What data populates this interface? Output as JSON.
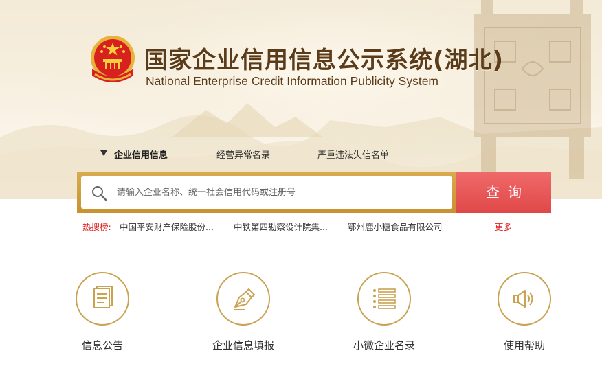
{
  "header": {
    "title_cn": "国家企业信用信息公示系统(湖北)",
    "title_en": "National Enterprise Credit Information Publicity System",
    "emblem": "national-emblem-icon"
  },
  "tabs": [
    {
      "label": "企业信用信息",
      "active": true
    },
    {
      "label": "经营异常名录",
      "active": false
    },
    {
      "label": "严重违法失信名单",
      "active": false
    }
  ],
  "search": {
    "placeholder": "请输入企业名称、统一社会信用代码或注册号",
    "value": "",
    "button_label": "查询"
  },
  "hot_search": {
    "label": "热搜榜:",
    "items": [
      "中国平安财产保险股份...",
      "中铁第四勘察设计院集...",
      "鄂州鹿小糖食品有限公司"
    ],
    "more": "更多"
  },
  "features": [
    {
      "label": "信息公告",
      "icon": "document-icon"
    },
    {
      "label": "企业信息填报",
      "icon": "pen-nib-icon"
    },
    {
      "label": "小微企业名录",
      "icon": "list-icon"
    },
    {
      "label": "使用帮助",
      "icon": "speaker-icon"
    }
  ],
  "colors": {
    "gold": "#c9a252",
    "search_button": "#e85858",
    "hot_red": "#dd2222",
    "title_brown": "#5a3c1b"
  }
}
